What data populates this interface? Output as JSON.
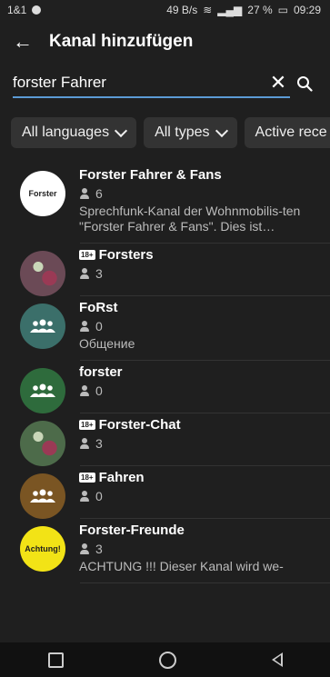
{
  "statusbar": {
    "carrier": "1&1",
    "speed": "49 B/s",
    "battery": "27 %",
    "time": "09:29"
  },
  "appbar": {
    "title": "Kanal hinzufügen"
  },
  "search": {
    "value": "forster Fahrer"
  },
  "filters": [
    "All languages",
    "All types",
    "Active rece"
  ],
  "channels": [
    {
      "name": "Forster Fahrer & Fans",
      "members": "6",
      "adult": false,
      "description": "Sprechfunk-Kanal der Wohnmobilis-ten \"Forster Fahrer & Fans\". Dies ist…",
      "avatar": "logo",
      "avatar_color": "#ffffff",
      "logo_text": "Forster"
    },
    {
      "name": "Forsters",
      "members": "3",
      "adult": true,
      "description": "",
      "avatar": "photo",
      "avatar_color": "#6b4a56"
    },
    {
      "name": "FoRst",
      "members": "0",
      "adult": false,
      "description": "Общение",
      "avatar": "group",
      "avatar_color": "#3b6f6a"
    },
    {
      "name": "forster",
      "members": "0",
      "adult": false,
      "description": "",
      "avatar": "group",
      "avatar_color": "#2e6b3c"
    },
    {
      "name": "Forster-Chat",
      "members": "3",
      "adult": true,
      "description": "",
      "avatar": "photo",
      "avatar_color": "#4d6b4a"
    },
    {
      "name": "Fahren",
      "members": "0",
      "adult": true,
      "description": "",
      "avatar": "group",
      "avatar_color": "#7a5523"
    },
    {
      "name": "Forster-Freunde",
      "members": "3",
      "adult": false,
      "description": "ACHTUNG !!! Dieser Kanal wird we-",
      "avatar": "logo",
      "avatar_color": "#f2e316",
      "logo_text": "Achtung!"
    }
  ]
}
